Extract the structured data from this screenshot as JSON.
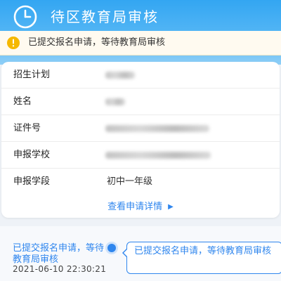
{
  "header": {
    "title": "待区教育局审核",
    "icon": "clock-icon"
  },
  "notice": {
    "icon": "warning-icon",
    "text": "已提交报名申请，等待教育局审核"
  },
  "form": {
    "rows": [
      {
        "label": "招生计划",
        "value": "",
        "redacted": true
      },
      {
        "label": "姓名",
        "value": "",
        "redacted": true
      },
      {
        "label": "证件号",
        "value": "",
        "redacted": true
      },
      {
        "label": "申报学校",
        "value": "",
        "redacted": true
      },
      {
        "label": "申报学段",
        "value": "初中一年级",
        "redacted": false
      }
    ],
    "details_link": "查看申请详情"
  },
  "timeline": {
    "status": "已提交报名申请，等待教育局审核",
    "timestamp": "2021-06-10 22:30:21",
    "bubble_text": "已提交报名申请，等待教育局审核"
  },
  "colors": {
    "header": "#33a6f2",
    "accent": "#2f86ee",
    "warning": "#f5b800"
  }
}
